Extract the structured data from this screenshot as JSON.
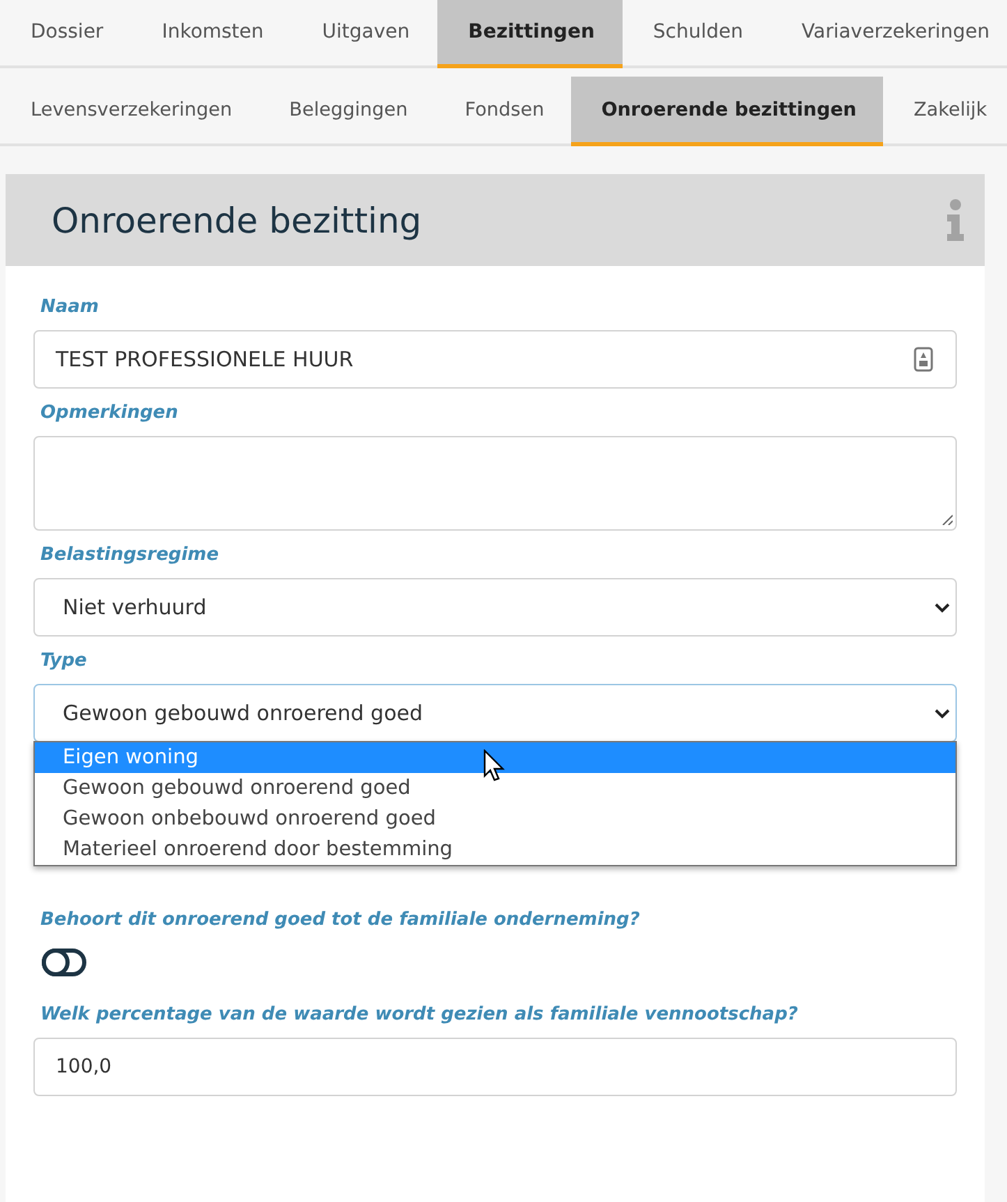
{
  "main_tabs": [
    {
      "label": "Dossier",
      "selected": false
    },
    {
      "label": "Inkomsten",
      "selected": false
    },
    {
      "label": "Uitgaven",
      "selected": false
    },
    {
      "label": "Bezittingen",
      "selected": true
    },
    {
      "label": "Schulden",
      "selected": false
    },
    {
      "label": "Variaverzekeringen",
      "selected": false
    }
  ],
  "sub_tabs": [
    {
      "label": "Levensverzekeringen",
      "selected": false
    },
    {
      "label": "Beleggingen",
      "selected": false
    },
    {
      "label": "Fondsen",
      "selected": false
    },
    {
      "label": "Onroerende bezittingen",
      "selected": true
    },
    {
      "label": "Zakelijk",
      "selected": false
    }
  ],
  "panel": {
    "title": "Onroerende bezitting",
    "naam": {
      "label": "Naam",
      "value": "TEST PROFESSIONELE HUUR"
    },
    "opmerkingen": {
      "label": "Opmerkingen"
    },
    "belastingsregime": {
      "label": "Belastingsregime",
      "value": "Niet verhuurd"
    },
    "type": {
      "label": "Type",
      "value": "Gewoon gebouwd onroerend goed",
      "options": [
        {
          "label": "Eigen woning",
          "highlighted": true
        },
        {
          "label": "Gewoon gebouwd onroerend goed",
          "highlighted": false
        },
        {
          "label": "Gewoon onbebouwd onroerend goed",
          "highlighted": false
        },
        {
          "label": "Materieel onroerend door bestemming",
          "highlighted": false
        }
      ]
    },
    "familiale_onderneming": {
      "label": "Behoort dit onroerend goed tot de familiale onderneming?",
      "on": false
    },
    "percentage": {
      "label": "Welk percentage van de waarde wordt gezien als familiale vennootschap?",
      "value": "100,0"
    }
  }
}
